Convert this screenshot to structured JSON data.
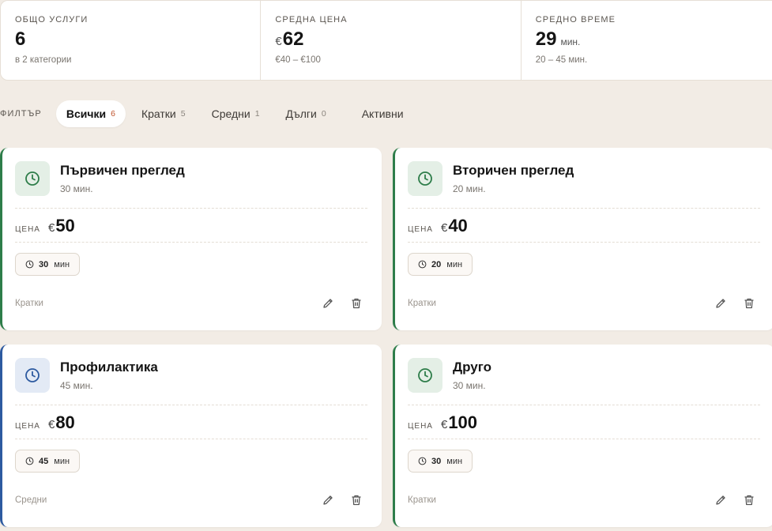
{
  "stats": [
    {
      "label": "ОБЩО УСЛУГИ",
      "currency": "",
      "value": "6",
      "unit": "",
      "sub": "в 2 категории"
    },
    {
      "label": "СРЕДНА ЦЕНА",
      "currency": "€",
      "value": "62",
      "unit": "",
      "sub": "€40 – €100"
    },
    {
      "label": "СРЕДНО ВРЕМЕ",
      "currency": "",
      "value": "29",
      "unit": "мин.",
      "sub": "20 – 45 мин."
    }
  ],
  "filters": {
    "label": "ФИЛТЪР",
    "chips": [
      {
        "label": "Всички",
        "count": "6"
      },
      {
        "label": "Кратки",
        "count": "5"
      },
      {
        "label": "Средни",
        "count": "1"
      },
      {
        "label": "Дълги",
        "count": "0"
      }
    ],
    "active_only": "Активни"
  },
  "cards": [
    {
      "title": "Първичен преглед",
      "duration": "30 мин.",
      "price_label": "ЦЕНА",
      "currency": "€",
      "price": "50",
      "pill_num": "30",
      "pill_unit": "мин",
      "category": "Кратки",
      "accent": "#2e7d4a"
    },
    {
      "title": "Вторичен преглед",
      "duration": "20 мин.",
      "price_label": "ЦЕНА",
      "currency": "€",
      "price": "40",
      "pill_num": "20",
      "pill_unit": "мин",
      "category": "Кратки",
      "accent": "#2e7d4a"
    },
    {
      "title": "Профилактика",
      "duration": "45 мин.",
      "price_label": "ЦЕНА",
      "currency": "€",
      "price": "80",
      "pill_num": "45",
      "pill_unit": "мин",
      "category": "Средни",
      "accent": "#2d5aa0"
    },
    {
      "title": "Друго",
      "duration": "30 мин.",
      "price_label": "ЦЕНА",
      "currency": "€",
      "price": "100",
      "pill_num": "30",
      "pill_unit": "мин",
      "category": "Кратки",
      "accent": "#2e7d4a"
    }
  ]
}
